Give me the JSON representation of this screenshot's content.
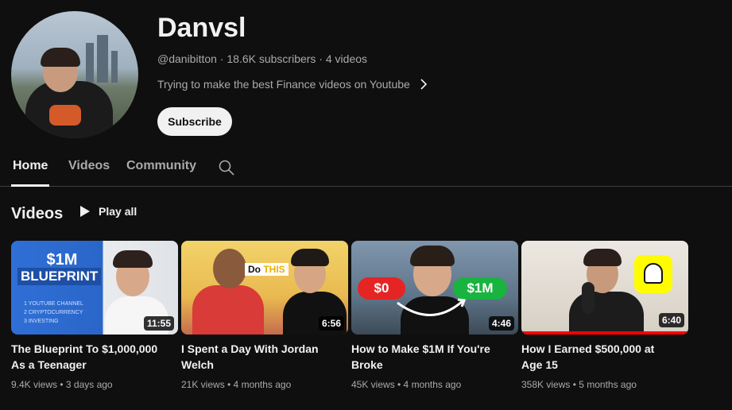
{
  "channel": {
    "name": "Danvsl",
    "meta": "@danibitton · 18.6K subscribers · 4 videos",
    "description": "Trying to make the best Finance videos on Youtube",
    "subscribe_label": "Subscribe"
  },
  "tabs": [
    {
      "label": "Home",
      "active": true
    },
    {
      "label": "Videos",
      "active": false
    },
    {
      "label": "Community",
      "active": false
    }
  ],
  "section": {
    "title": "Videos",
    "play_all_label": "Play all"
  },
  "videos": [
    {
      "title_line1": "The Blueprint To $1,000,000",
      "title_line2": "As a Teenager",
      "meta": "9.4K views • 3 days ago",
      "duration": "11:55",
      "thumb_text_1": "$1M",
      "thumb_text_2": "BLUEPRINT",
      "thumb_list": [
        "1 YOUTUBE CHANNEL",
        "2 CRYPTOCURRENCY",
        "3 INVESTING"
      ]
    },
    {
      "title_line1": "I Spent a Day With Jordan",
      "title_line2": "Welch",
      "meta": "21K views • 4 months ago",
      "duration": "6:56",
      "thumb_text_1": "Do",
      "thumb_text_2": "THIS"
    },
    {
      "title_line1": "How to Make $1M If You're",
      "title_line2": "Broke",
      "meta": "45K views • 4 months ago",
      "duration": "4:46",
      "thumb_text_1": "$0",
      "thumb_text_2": "$1M"
    },
    {
      "title_line1": "How I Earned $500,000 at",
      "title_line2": "Age 15",
      "meta": "358K views • 5 months ago",
      "duration": "6:40",
      "watch_progress": 1.0
    }
  ],
  "colors": {
    "background": "#0f0f0f",
    "text_primary": "#f1f1f1",
    "text_secondary": "#aaaaaa",
    "progress_red": "#ff0000"
  }
}
